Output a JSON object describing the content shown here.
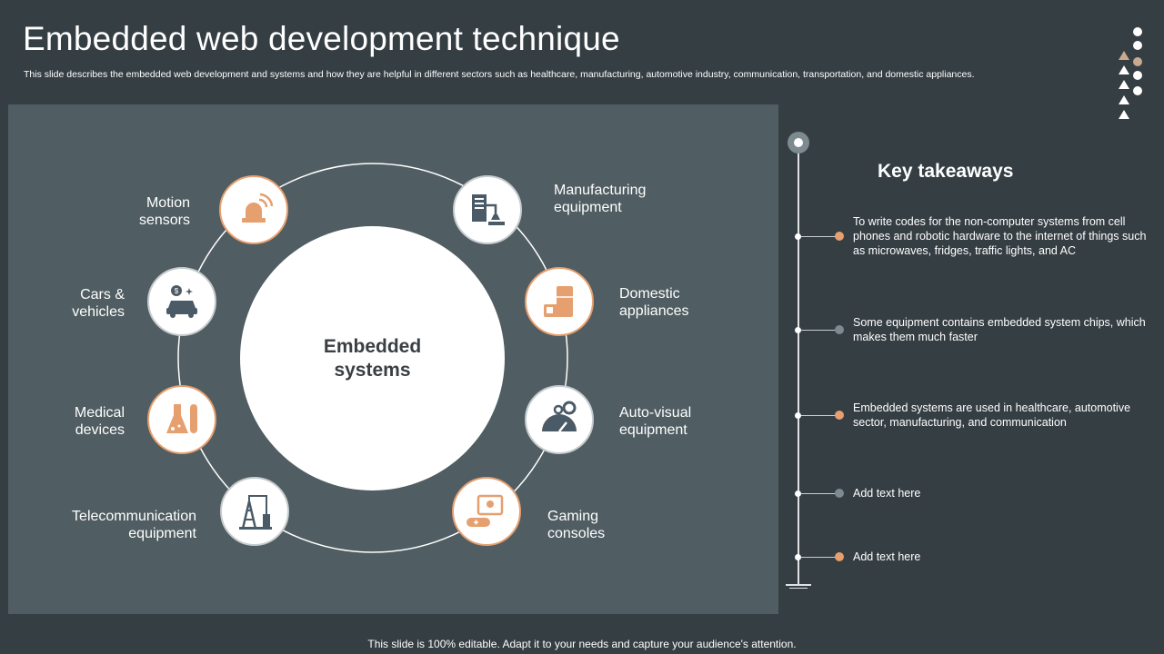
{
  "header": {
    "title": "Embedded web development technique",
    "subtitle": "This slide describes the embedded web development and systems and how they are helpful in different sectors such as healthcare, manufacturing, automotive industry, communication, transportation, and domestic appliances."
  },
  "diagram": {
    "center_label": "Embedded\nsystems",
    "nodes": [
      {
        "label": "Motion\nsensors",
        "icon": "alarm-siren-icon",
        "accent": "orange"
      },
      {
        "label": "Manufacturing\nequipment",
        "icon": "factory-machine-icon",
        "accent": "gray"
      },
      {
        "label": "Cars &\nvehicles",
        "icon": "car-money-icon",
        "accent": "gray"
      },
      {
        "label": "Domestic\nappliances",
        "icon": "appliances-icon",
        "accent": "orange"
      },
      {
        "label": "Medical\ndevices",
        "icon": "lab-flask-icon",
        "accent": "orange"
      },
      {
        "label": "Auto-visual\nequipment",
        "icon": "gauge-gears-icon",
        "accent": "gray"
      },
      {
        "label": "Telecommunication\nequipment",
        "icon": "antenna-tower-icon",
        "accent": "gray"
      },
      {
        "label": "Gaming\nconsoles",
        "icon": "gamepad-icon",
        "accent": "orange"
      }
    ]
  },
  "takeaways": {
    "title": "Key takeaways",
    "items": [
      {
        "text": "To write codes for the non-computer systems from cell phones and robotic hardware to the internet of things such as microwaves, fridges, traffic lights, and AC",
        "accent": "orange"
      },
      {
        "text": "Some equipment contains embedded system chips, which makes them much faster",
        "accent": "gray"
      },
      {
        "text": "Embedded systems are used in healthcare, automotive sector, manufacturing, and communication",
        "accent": "orange"
      },
      {
        "text": "Add text here",
        "accent": "gray"
      },
      {
        "text": "Add text here",
        "accent": "orange"
      }
    ]
  },
  "footer": {
    "note": "This slide is 100% editable. Adapt it to your needs and capture your audience's attention."
  },
  "colors": {
    "background": "#353e43",
    "panel": "#505d62",
    "orange": "#e6a06f",
    "gray": "#7d8a8f",
    "icon_dark": "#4a5a66"
  }
}
